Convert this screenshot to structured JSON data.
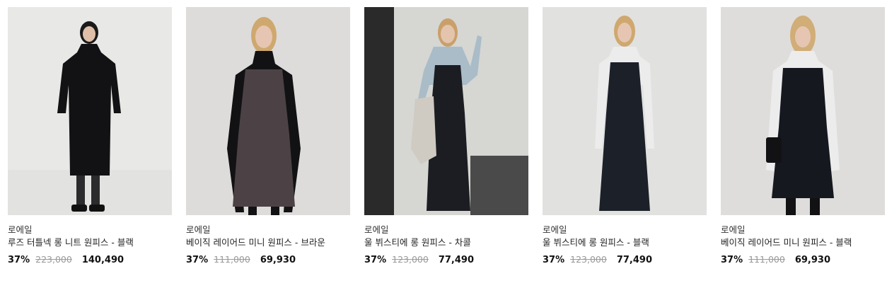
{
  "products": [
    {
      "brand": "로에일",
      "name": "루즈 터틀넥 롱 니트 원피스 - 블랙",
      "discount": "37%",
      "original_price": "223,000",
      "sale_price": "140,490",
      "image_icon": "model-photo"
    },
    {
      "brand": "로에일",
      "name": "베이직 레이어드 미니 원피스 - 브라운",
      "discount": "37%",
      "original_price": "111,000",
      "sale_price": "69,930",
      "image_icon": "model-photo"
    },
    {
      "brand": "로에일",
      "name": "울 뷔스티에 롱 원피스 - 차콜",
      "discount": "37%",
      "original_price": "123,000",
      "sale_price": "77,490",
      "image_icon": "model-photo"
    },
    {
      "brand": "로에일",
      "name": "울 뷔스티에 롱 원피스 - 블랙",
      "discount": "37%",
      "original_price": "123,000",
      "sale_price": "77,490",
      "image_icon": "model-photo"
    },
    {
      "brand": "로에일",
      "name": "베이직 레이어드 미니 원피스 - 블랙",
      "discount": "37%",
      "original_price": "111,000",
      "sale_price": "69,930",
      "image_icon": "model-photo"
    }
  ],
  "colors": {
    "studio_bg": "#e6e6e4",
    "wall_bg": "#d8d8d6",
    "black": "#141416",
    "brown": "#4d4346",
    "navy": "#1c2029",
    "light_blue": "#a9bcc8",
    "white_knit": "#ececec",
    "skin": "#e3c3ae",
    "hair": "#d1ad77",
    "hair_dark": "#1a1a1a"
  }
}
